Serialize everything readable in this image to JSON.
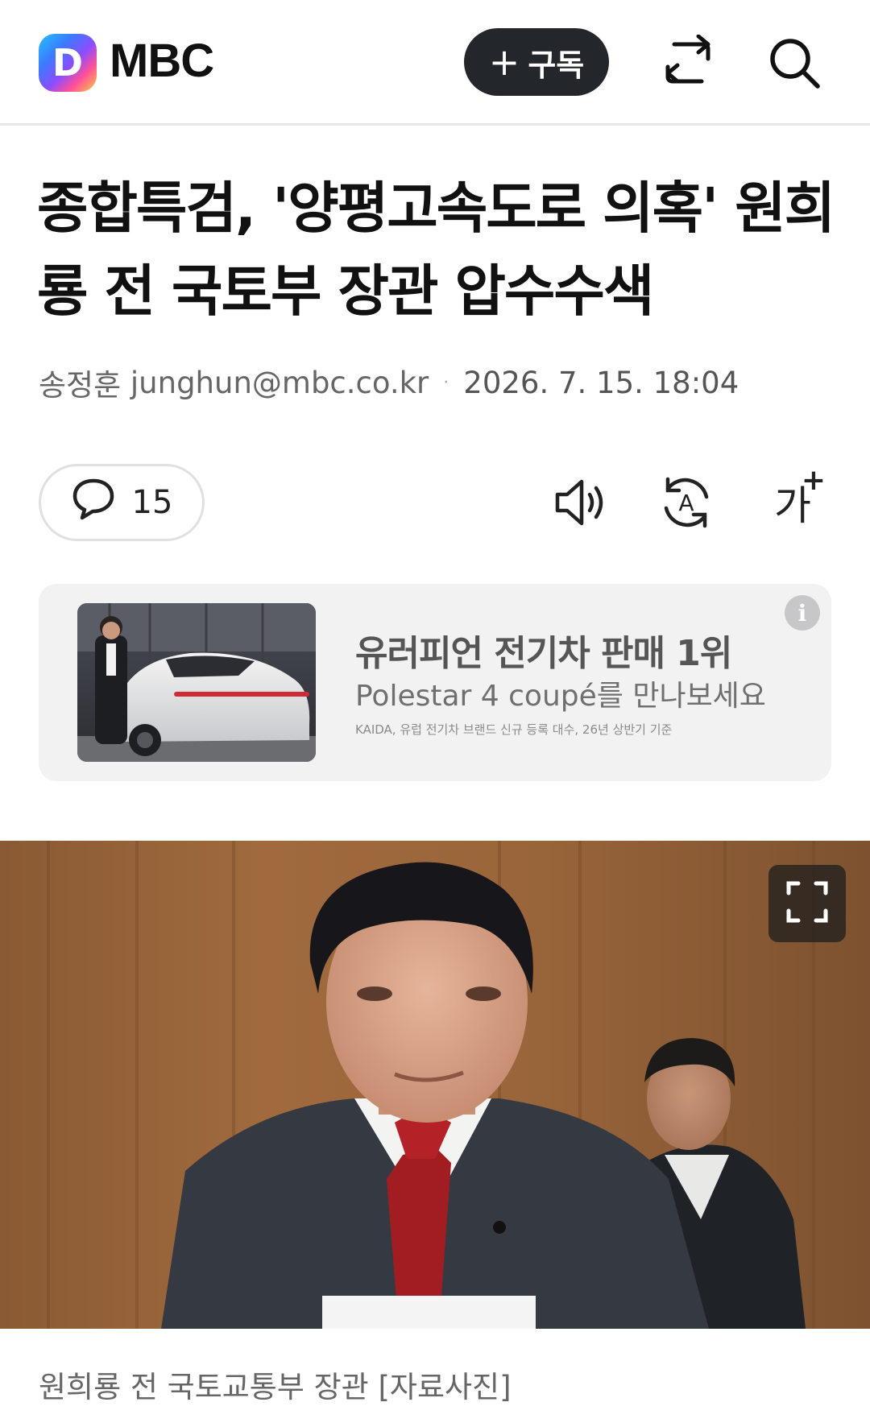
{
  "header": {
    "logo_letter": "D",
    "brand": "MBC",
    "subscribe_plus": "+",
    "subscribe_label": "구독",
    "share_icon": "share-icon",
    "search_icon": "search-icon"
  },
  "article": {
    "title": "종합특검, '양평고속도로 의혹' 원희룡 전 국토부 장관 압수수색",
    "author": "송정훈",
    "email": "junghun@mbc.co.kr",
    "separator": "·",
    "date": "2026. 7. 15. 18:04"
  },
  "actions": {
    "comment_count": "15",
    "font_size_label": "가",
    "font_size_plus": "+",
    "tts_icon": "speaker-icon",
    "translate_icon": "auto-translate-icon",
    "translate_letter": "A"
  },
  "ad": {
    "headline": "유러피언 전기차 판매 1위",
    "subline": "Polestar 4 coupé를 만나보세요",
    "fineprint": "KAIDA, 유럽 전기차 브랜드 신규 등록 대수, 26년 상반기 기준",
    "info_label": "i"
  },
  "photo": {
    "caption": "원희룡 전 국토교통부 장관 [자료사진]"
  },
  "colors": {
    "subscribe_bg": "#23262b",
    "ad_bg": "#f2f2f3",
    "text_primary": "#111111",
    "text_secondary": "#666666"
  }
}
